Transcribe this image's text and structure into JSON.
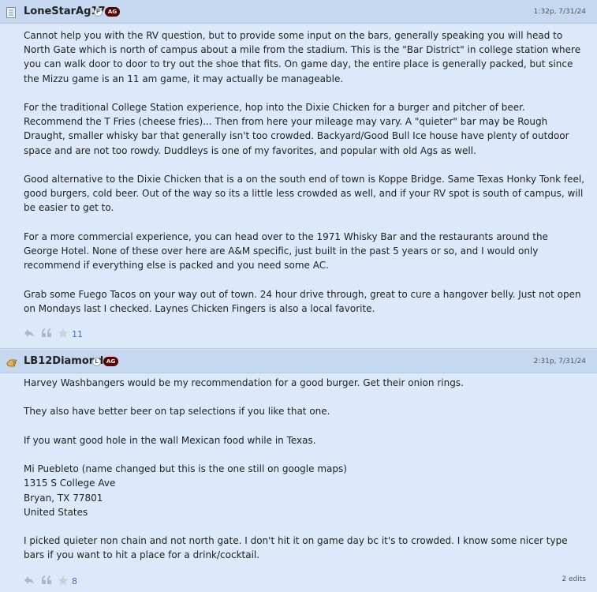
{
  "posts": [
    {
      "username": "LoneStarAg17",
      "status_letter": "P",
      "team_badge": "AG",
      "timestamp": "1:32p, 7/31/24",
      "paragraphs": [
        "Cannot help you with the RV question, but to provide some input on the bars, generally speaking you will head to North Gate which is north of campus about a mile from the stadium. This is the \"Bar District\" in college station where you can walk door to door to try out the shoe that fits. On game day, the entire place is generally packed, but since the Mizzu game is an 11 am game, it may actually be manageable.",
        "For the traditional College Station experience, hop into the Dixie Chicken for a burger and pitcher of beer. Recommend the T Fries (cheese fries)... Then from here your mileage may vary. A \"quieter\" bar may be Rough Draught, smaller whisky bar that generally isn't too crowded. Backyard/Good Bull Ice house have plenty of outdoor space and are not too rowdy. Duddleys is one of my favorites, and popular with old Ags as well.",
        "Good alternative to the Dixie Chicken that is a on the south end of town is Koppe Bridge. Same Texas Honky Tonk feel, good burgers, cold beer. Out of the way so its a little less crowded as well, and if your RV spot is south of campus, will be easier to get to.",
        "For a more commercial experience, you can head over to the 1971 Whisky Bar and the restaurants around the George Hotel. None of these over here are A&M specific, just built in the past 5 years or so, and I would only recommend if everything else is packed and you need some AC.",
        "Grab some Fuego Tacos on your way out of town. 24 hour drive through, great to cure a hangover belly. Just not open on Mondays last I checked. Laynes Chicken Fingers is also a local favorite."
      ],
      "star_count": "11"
    },
    {
      "username": "LB12Diamond",
      "status_letter": "L",
      "team_badge": "AG",
      "timestamp": "2:31p, 7/31/24",
      "paragraphs": [
        "Harvey Washbangers would be my recommendation for a good burger. Get their onion rings.",
        "They also have better beer on tap selections if you like that one.",
        "If you want good hole in the wall Mexican food while in Texas."
      ],
      "address_lines": [
        "Mi Puebleto (name changed but this is the one still on google maps)",
        "1315 S College Ave",
        "Bryan, TX 77801",
        "United States"
      ],
      "closing": "I picked quieter non chain and not north gate. I don't hit it on game day bc it's to crowded. I know some nicer type bars if you want to hit a place for a drink/cocktail.",
      "star_count": "8",
      "edits": "2 edits"
    }
  ],
  "colors": {
    "post_bg": "#dbe9fb",
    "header_bg": "#c5d8f0",
    "ag_badge": "#5b0000",
    "count_text": "#4a72b0"
  },
  "icons": [
    "document-icon",
    "pointing-hand-icon",
    "reply-icon",
    "quote-icon",
    "star-icon"
  ]
}
